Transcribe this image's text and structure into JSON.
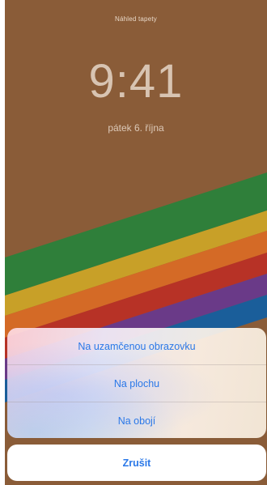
{
  "lock_screen": {
    "preview_title": "Náhled tapety",
    "time": "9:41",
    "date": "pátek 6. října"
  },
  "action_sheet": {
    "options": [
      "Na uzamčenou obrazovku",
      "Na plochu",
      "Na obojí"
    ],
    "cancel_label": "Zrušit"
  },
  "colors": {
    "wallpaper_background": "#8a5c38",
    "stripes": [
      "#2f7f3a",
      "#c8a028",
      "#d46a26",
      "#b73226",
      "#6a3a88",
      "#1a5e9a"
    ],
    "action_text": "#2a78e8"
  }
}
